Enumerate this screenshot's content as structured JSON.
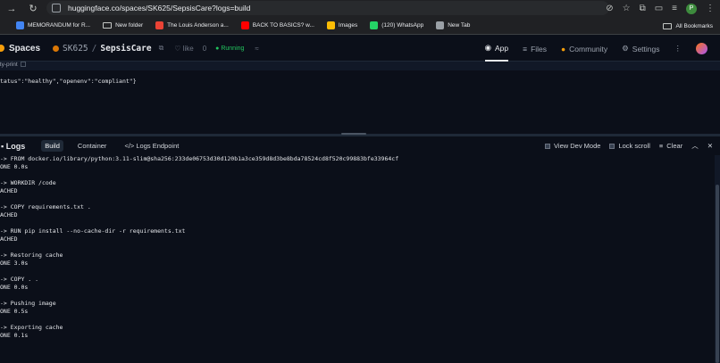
{
  "browser": {
    "url": "huggingface.co/spaces/SK625/SepsisCare?logs=build",
    "profile_initial": "P"
  },
  "bookmarks": {
    "items": [
      {
        "label": "MEMORANDUM for R...",
        "color": "#4285f4"
      },
      {
        "label": "New folder",
        "color": "folder"
      },
      {
        "label": "The Louis Anderson a...",
        "color": "#ea4335"
      },
      {
        "label": "BACK TO BASICS? w...",
        "color": "#ff0000"
      },
      {
        "label": "Images",
        "color": "#fbbc05"
      },
      {
        "label": "(120) WhatsApp",
        "color": "#25d366"
      },
      {
        "label": "New Tab",
        "color": "#9aa0a6"
      }
    ],
    "all": "All Bookmarks"
  },
  "hf": {
    "spaces": "Spaces",
    "owner": "SK625",
    "separator": "/",
    "space_name": "SepsisCare",
    "like_label": "like",
    "like_count": "0",
    "status": "● Running",
    "tabs": [
      "App",
      "Files",
      "Community",
      "Settings"
    ]
  },
  "app": {
    "pretty_label": "tty-print",
    "json_text": "tatus\":\"healthy\",\"openenv\":\"compliant\"}"
  },
  "logs": {
    "title": "Logs",
    "tabs": [
      "Build",
      "Container",
      "</> Logs Endpoint"
    ],
    "view_dev": "View Dev Mode",
    "lock_scroll": "Lock scroll",
    "clear": "Clear",
    "lines": [
      "-> FROM docker.io/library/python:3.11-slim@sha256:233de06753d30d120b1a3ce359d8d3be8bda78524cd8f520c99883bfe33964cf",
      "ONE 0.0s",
      "",
      "-> WORKDIR /code",
      "ACHED",
      "",
      "-> COPY requirements.txt .",
      "ACHED",
      "",
      "-> RUN pip install --no-cache-dir -r requirements.txt",
      "ACHED",
      "",
      "-> Restoring cache",
      "ONE 3.0s",
      "",
      "-> COPY . .",
      "ONE 0.0s",
      "",
      "-> Pushing image",
      "ONE 0.5s",
      "",
      "-> Exporting cache",
      "ONE 0.1s"
    ]
  }
}
